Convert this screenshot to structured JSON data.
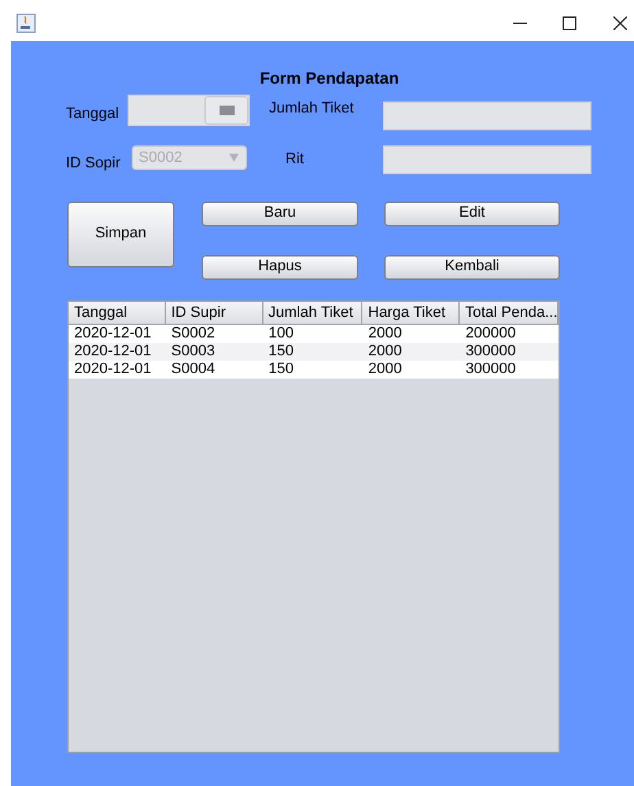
{
  "form": {
    "title": "Form Pendapatan",
    "tanggal": {
      "label": "Tanggal"
    },
    "jumlah_tiket": {
      "label": "Jumlah Tiket"
    },
    "id_sopir": {
      "label": "ID Sopir",
      "value": "S0002",
      "disabled": true
    },
    "rit": {
      "label": "Rit"
    }
  },
  "buttons": {
    "simpan": "Simpan",
    "baru": "Baru",
    "edit": "Edit",
    "hapus": "Hapus",
    "kembali": "Kembali"
  },
  "table": {
    "columns": [
      "Tanggal",
      "ID Supir",
      "Jumlah Tiket",
      "Harga Tiket",
      "Total Penda..."
    ],
    "rows": [
      [
        "2020-12-01",
        "S0002",
        "100",
        "2000",
        "200000"
      ],
      [
        "2020-12-01",
        "S0003",
        "150",
        "2000",
        "300000"
      ],
      [
        "2020-12-01",
        "S0004",
        "150",
        "2000",
        "300000"
      ]
    ]
  }
}
